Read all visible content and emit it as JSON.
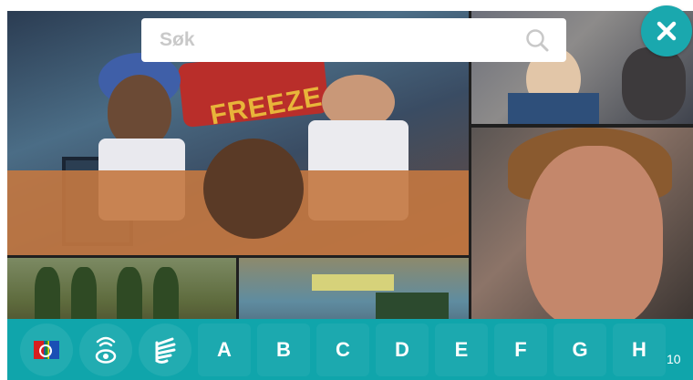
{
  "search": {
    "placeholder": "Søk",
    "value": ""
  },
  "thumbnails": {
    "main": {
      "sign_text": "FREEZE"
    }
  },
  "bottom_bar": {
    "icons": [
      "sami-flag-icon",
      "audio-description-icon",
      "sign-language-icon"
    ],
    "letters": [
      "A",
      "B",
      "C",
      "D",
      "E",
      "F",
      "G",
      "H"
    ]
  },
  "page_number": "10",
  "colors": {
    "accent": "#10a5ab",
    "close": "#1aa8ae",
    "search_bg": "#ffffff"
  }
}
